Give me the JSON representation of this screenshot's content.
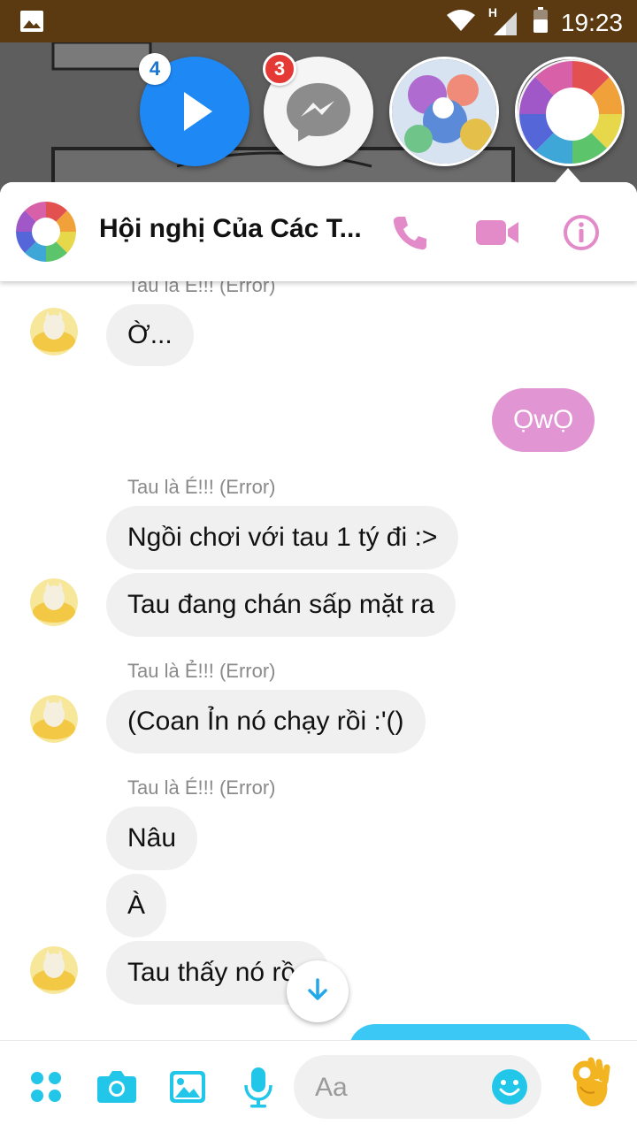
{
  "status_bar": {
    "time": "19:23",
    "network_type": "H",
    "icons": [
      "image-icon",
      "wifi-icon",
      "signal-icon",
      "battery-icon"
    ]
  },
  "chat_heads": [
    {
      "name": "play-head",
      "badge": "4"
    },
    {
      "name": "messenger-head",
      "badge": "3"
    },
    {
      "name": "group-art-head"
    },
    {
      "name": "undertale-au-head"
    }
  ],
  "conversation": {
    "title": "Hội nghị Của Các T...",
    "header_icons": [
      "phone-icon",
      "video-camera-icon",
      "info-icon"
    ]
  },
  "messages": [
    {
      "sender": "Tau là É!!! (Error)"
    },
    {
      "text": "Ờ..."
    },
    {
      "text": "ỌwỌ"
    },
    {
      "sender": "Tau là É!!! (Error)"
    },
    {
      "text": "Ngồi chơi với tau 1 tý đi :>"
    },
    {
      "text": "Tau đang chán sấp mặt ra"
    },
    {
      "sender": "Tau là Ẻ!!! (Error)"
    },
    {
      "text": "(Coan Ỉn nó chạy rồi :'()"
    },
    {
      "sender": "Tau là É!!! (Error)"
    },
    {
      "text": "Nâu"
    },
    {
      "text": "À"
    },
    {
      "text": "Tau thấy nó rồ"
    }
  ],
  "composer": {
    "placeholder": "Aa",
    "icons": [
      "apps-icon",
      "camera-icon",
      "gallery-icon",
      "microphone-icon",
      "emoji-icon",
      "ok-hand-emoji-icon"
    ]
  },
  "colors": {
    "accent_pink": "#e38ac9",
    "outgoing_bubble": "#e195d2",
    "incoming_bubble": "#f1f0f0",
    "composer_cyan": "#22c6e8",
    "status_bar": "#5b3a12"
  }
}
